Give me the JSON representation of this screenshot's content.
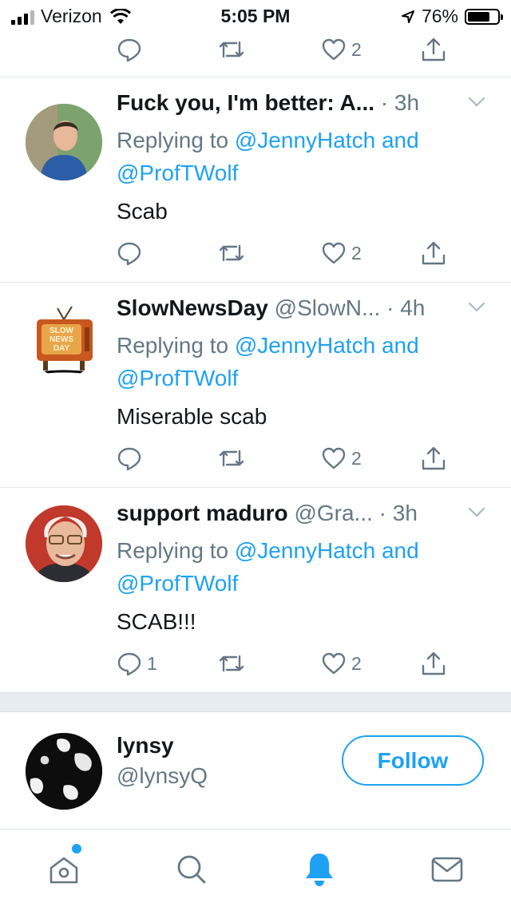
{
  "status_bar": {
    "carrier": "Verizon",
    "time": "5:05 PM",
    "battery_text": "76%",
    "battery_level": 0.76
  },
  "top_actions": {
    "like_count": "2"
  },
  "tweets": [
    {
      "name": "Fuck you, I'm better: A...",
      "handle": "",
      "time": "· 3h",
      "replying_prefix": "Replying to ",
      "mention1": "@JennyHatch",
      "and_text": " and",
      "mention2": "@ProfTWolf",
      "body": "Scab",
      "reply_count": "",
      "like_count": "2"
    },
    {
      "name": "SlowNewsDay",
      "handle": "@SlowN...",
      "time": "· 4h",
      "replying_prefix": "Replying to ",
      "mention1": "@JennyHatch",
      "and_text": " and",
      "mention2": "@ProfTWolf",
      "body": "Miserable scab",
      "reply_count": "",
      "like_count": "2",
      "avatar_text": "SLOW NEWS DAY"
    },
    {
      "name": "support maduro",
      "handle": "@Gra...",
      "time": "· 3h",
      "replying_prefix": "Replying to ",
      "mention1": "@JennyHatch",
      "and_text": " and",
      "mention2": "@ProfTWolf",
      "body": "SCAB!!!",
      "reply_count": "1",
      "like_count": "2"
    }
  ],
  "suggested_follow": {
    "name": "lynsy",
    "handle": "@lynsyQ",
    "button_label": "Follow"
  },
  "tab_bar": {
    "items": [
      "home-icon",
      "search-icon",
      "notifications-bell-icon",
      "messages-mail-icon"
    ],
    "active": "notifications-bell-icon",
    "accent_color": "#1da1f2",
    "icon_color": "#657786"
  }
}
